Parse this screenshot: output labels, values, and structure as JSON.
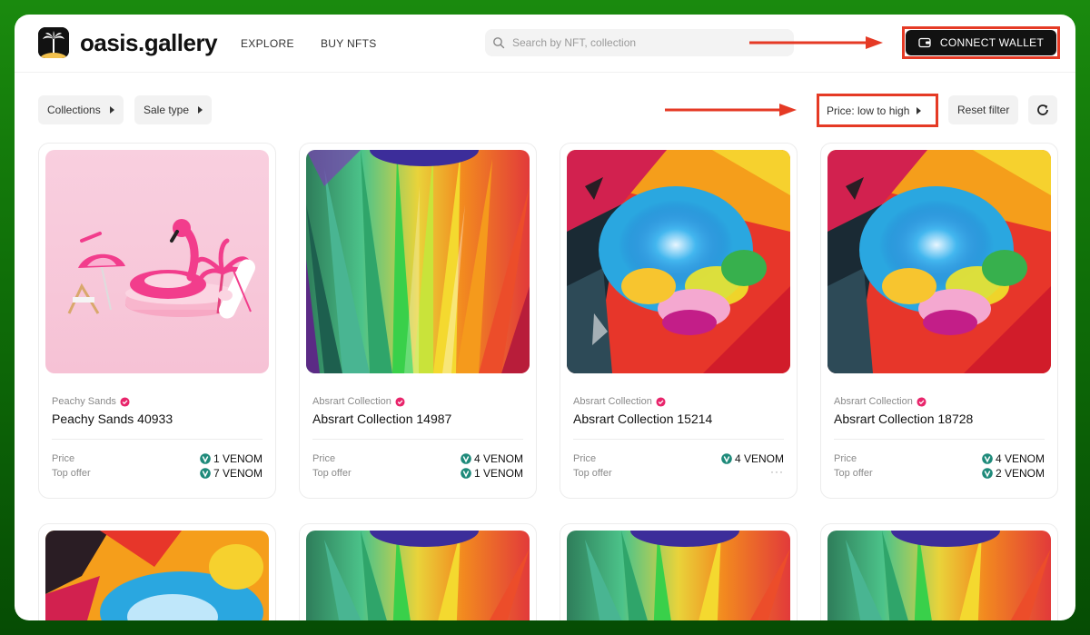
{
  "header": {
    "brand": "oasis.gallery",
    "nav": [
      "EXPLORE",
      "BUY NFTS"
    ],
    "search_placeholder": "Search by NFT, collection",
    "connect_label": "CONNECT WALLET"
  },
  "filters": {
    "collections_label": "Collections",
    "sale_type_label": "Sale type",
    "sort_label": "Price: low to high",
    "reset_label": "Reset filter"
  },
  "labels": {
    "price": "Price",
    "top_offer": "Top offer"
  },
  "cards": [
    {
      "collection": "Peachy Sands",
      "name": "Peachy Sands 40933",
      "price": "1 VENOM",
      "top_offer": "7 VENOM",
      "art": "flamingo-art"
    },
    {
      "collection": "Absrart Collection",
      "name": "Absrart Collection 14987",
      "price": "4 VENOM",
      "top_offer": "1 VENOM",
      "art": "rays-art"
    },
    {
      "collection": "Absrart Collection",
      "name": "Absrart Collection 15214",
      "price": "4 VENOM",
      "top_offer": "···",
      "art": "splash-art"
    },
    {
      "collection": "Absrart Collection",
      "name": "Absrart Collection 18728",
      "price": "4 VENOM",
      "top_offer": "2 VENOM",
      "art": "splash-art"
    }
  ],
  "colors": {
    "accent_red": "#e53a25",
    "verified": "#e8256b",
    "venom": "#1e8a7a",
    "dark": "#121212"
  }
}
